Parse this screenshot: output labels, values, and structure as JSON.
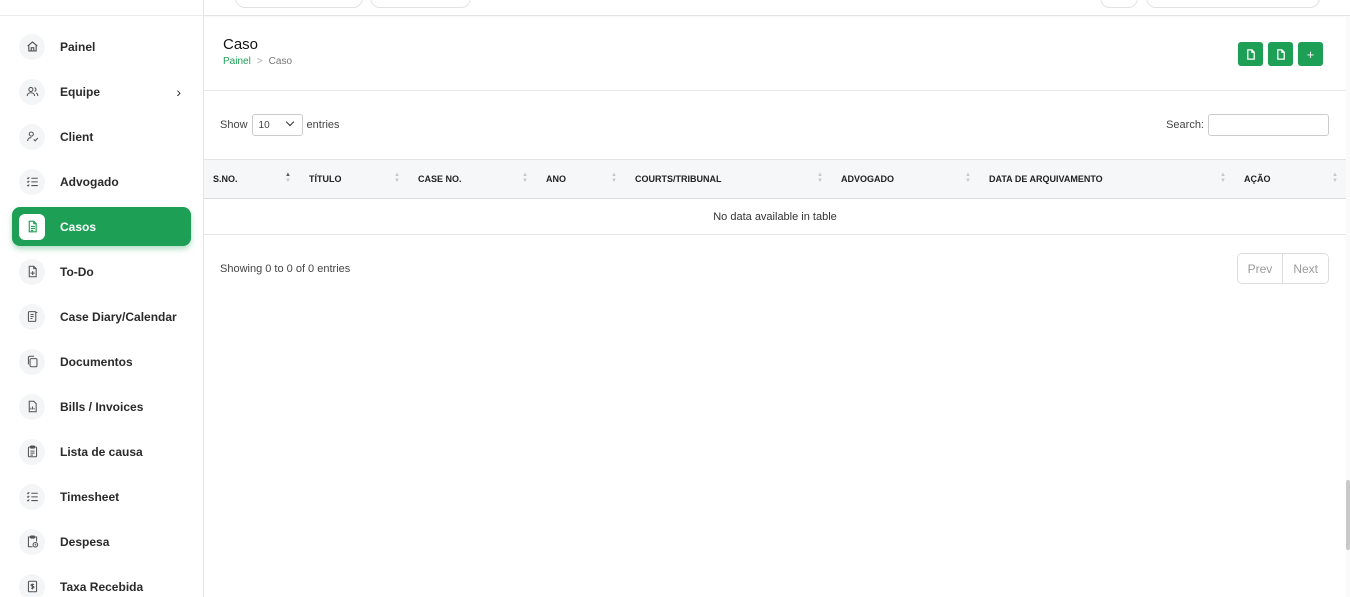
{
  "sidebar": {
    "items": [
      {
        "label": "Painel",
        "icon": "home-icon"
      },
      {
        "label": "Equipe",
        "icon": "users-icon",
        "chevron": "›"
      },
      {
        "label": "Client",
        "icon": "user-check-icon"
      },
      {
        "label": "Advogado",
        "icon": "list-check-icon"
      },
      {
        "label": "Casos",
        "icon": "file-text-icon",
        "active": true
      },
      {
        "label": "To-Do",
        "icon": "file-plus-icon"
      },
      {
        "label": "Case Diary/Calendar",
        "icon": "notebook-icon"
      },
      {
        "label": "Documentos",
        "icon": "copy-icon"
      },
      {
        "label": "Bills / Invoices",
        "icon": "invoice-icon"
      },
      {
        "label": "Lista de causa",
        "icon": "clipboard-icon"
      },
      {
        "label": "Timesheet",
        "icon": "list-check-icon"
      },
      {
        "label": "Despesa",
        "icon": "clipboard-clock-icon"
      },
      {
        "label": "Taxa Recebida",
        "icon": "receipt-icon"
      }
    ]
  },
  "page": {
    "title": "Caso",
    "breadcrumb": {
      "home": "Painel",
      "separator": ">",
      "current": "Caso"
    }
  },
  "actions": {
    "export1_icon": "file-icon",
    "export2_icon": "file-icon",
    "add_label": "+"
  },
  "controls": {
    "show_label": "Show",
    "entries_value": "10",
    "entries_label": "entries",
    "search_label": "Search:",
    "search_value": ""
  },
  "table": {
    "columns": [
      "S.NO.",
      "TÍTULO",
      "CASE NO.",
      "ANO",
      "COURTS/TRIBUNAL",
      "ADVOGADO",
      "DATA DE ARQUIVAMENTO",
      "AÇÃO"
    ],
    "empty_message": "No data available in table",
    "rows": []
  },
  "footer": {
    "info": "Showing 0 to 0 of 0 entries",
    "prev": "Prev",
    "next": "Next"
  },
  "colors": {
    "accent": "#1d9f55"
  }
}
